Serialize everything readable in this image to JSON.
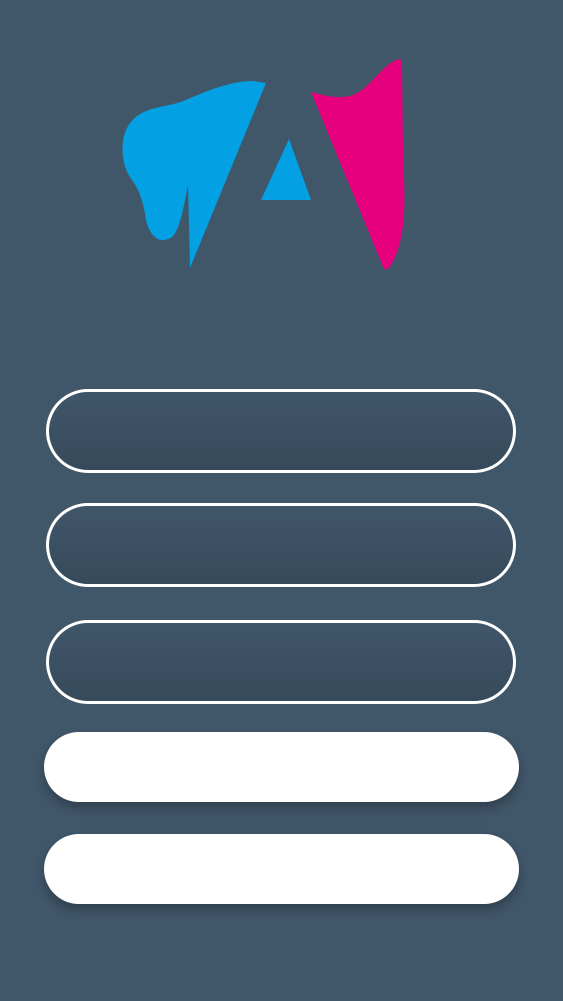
{
  "logo": {
    "name": "brand-logo",
    "colors": {
      "blue": "#04A0E4",
      "magenta": "#E6007E"
    }
  },
  "form": {
    "field1": {
      "value": "",
      "placeholder": ""
    },
    "field2": {
      "value": "",
      "placeholder": ""
    },
    "field3": {
      "value": "",
      "placeholder": ""
    }
  },
  "buttons": {
    "primary_label": "",
    "secondary_label": ""
  },
  "theme": {
    "background": "#405669",
    "field_border": "#FFFFFF",
    "button_fill": "#FFFFFF"
  }
}
